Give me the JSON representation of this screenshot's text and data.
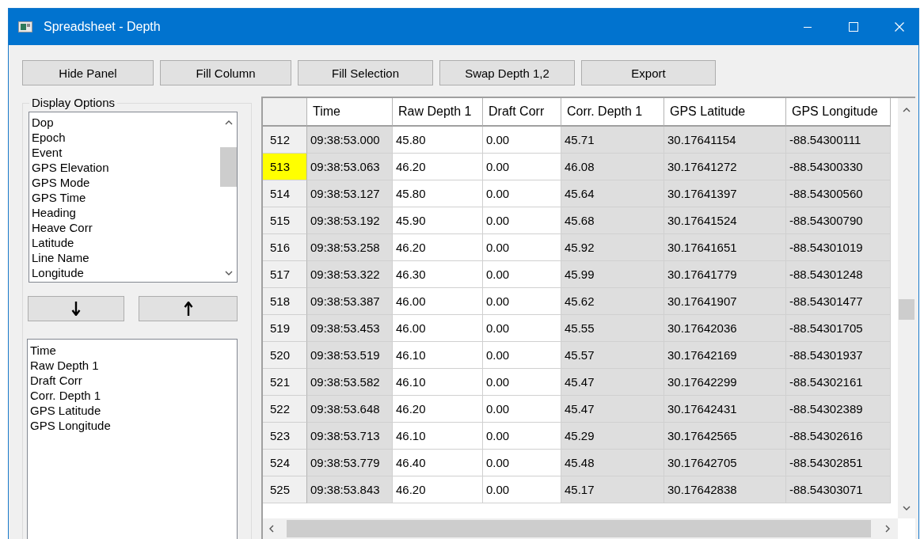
{
  "window": {
    "title": "Spreadsheet - Depth"
  },
  "toolbar": [
    "Hide Panel",
    "Fill Column",
    "Fill Selection",
    "Swap Depth 1,2",
    "Export"
  ],
  "display_options": {
    "title": "Display Options",
    "available": [
      "Dop",
      "Epoch",
      "Event",
      "GPS Elevation",
      "GPS Mode",
      "GPS Time",
      "Heading",
      "Heave Corr",
      "Latitude",
      "Line Name",
      "Longitude"
    ],
    "shown": [
      "Time",
      "Raw Depth 1",
      "Draft Corr",
      "Corr. Depth 1",
      "GPS Latitude",
      "GPS Longitude"
    ]
  },
  "table": {
    "columns": [
      {
        "label": "Time",
        "readonly": true
      },
      {
        "label": "Raw Depth 1",
        "readonly": false
      },
      {
        "label": "Draft Corr",
        "readonly": false
      },
      {
        "label": "Corr. Depth 1",
        "readonly": true
      },
      {
        "label": "GPS Latitude",
        "readonly": true
      },
      {
        "label": "GPS Longitude",
        "readonly": true
      }
    ],
    "rows": [
      {
        "index": "512",
        "selected": false,
        "cells": [
          "09:38:53.000",
          "45.80",
          "0.00",
          "45.71",
          "30.17641154",
          "-88.54300111"
        ]
      },
      {
        "index": "513",
        "selected": true,
        "cells": [
          "09:38:53.063",
          "46.20",
          "0.00",
          "46.08",
          "30.17641272",
          "-88.54300330"
        ]
      },
      {
        "index": "514",
        "selected": false,
        "cells": [
          "09:38:53.127",
          "45.80",
          "0.00",
          "45.64",
          "30.17641397",
          "-88.54300560"
        ]
      },
      {
        "index": "515",
        "selected": false,
        "cells": [
          "09:38:53.192",
          "45.90",
          "0.00",
          "45.68",
          "30.17641524",
          "-88.54300790"
        ]
      },
      {
        "index": "516",
        "selected": false,
        "cells": [
          "09:38:53.258",
          "46.20",
          "0.00",
          "45.92",
          "30.17641651",
          "-88.54301019"
        ]
      },
      {
        "index": "517",
        "selected": false,
        "cells": [
          "09:38:53.322",
          "46.30",
          "0.00",
          "45.99",
          "30.17641779",
          "-88.54301248"
        ]
      },
      {
        "index": "518",
        "selected": false,
        "cells": [
          "09:38:53.387",
          "46.00",
          "0.00",
          "45.62",
          "30.17641907",
          "-88.54301477"
        ]
      },
      {
        "index": "519",
        "selected": false,
        "cells": [
          "09:38:53.453",
          "46.00",
          "0.00",
          "45.55",
          "30.17642036",
          "-88.54301705"
        ]
      },
      {
        "index": "520",
        "selected": false,
        "cells": [
          "09:38:53.519",
          "46.10",
          "0.00",
          "45.57",
          "30.17642169",
          "-88.54301937"
        ]
      },
      {
        "index": "521",
        "selected": false,
        "cells": [
          "09:38:53.582",
          "46.10",
          "0.00",
          "45.47",
          "30.17642299",
          "-88.54302161"
        ]
      },
      {
        "index": "522",
        "selected": false,
        "cells": [
          "09:38:53.648",
          "46.20",
          "0.00",
          "45.47",
          "30.17642431",
          "-88.54302389"
        ]
      },
      {
        "index": "523",
        "selected": false,
        "cells": [
          "09:38:53.713",
          "46.10",
          "0.00",
          "45.29",
          "30.17642565",
          "-88.54302616"
        ]
      },
      {
        "index": "524",
        "selected": false,
        "cells": [
          "09:38:53.779",
          "46.40",
          "0.00",
          "45.48",
          "30.17642705",
          "-88.54302851"
        ]
      },
      {
        "index": "525",
        "selected": false,
        "cells": [
          "09:38:53.843",
          "46.20",
          "0.00",
          "45.17",
          "30.17642838",
          "-88.54303071"
        ]
      }
    ]
  }
}
